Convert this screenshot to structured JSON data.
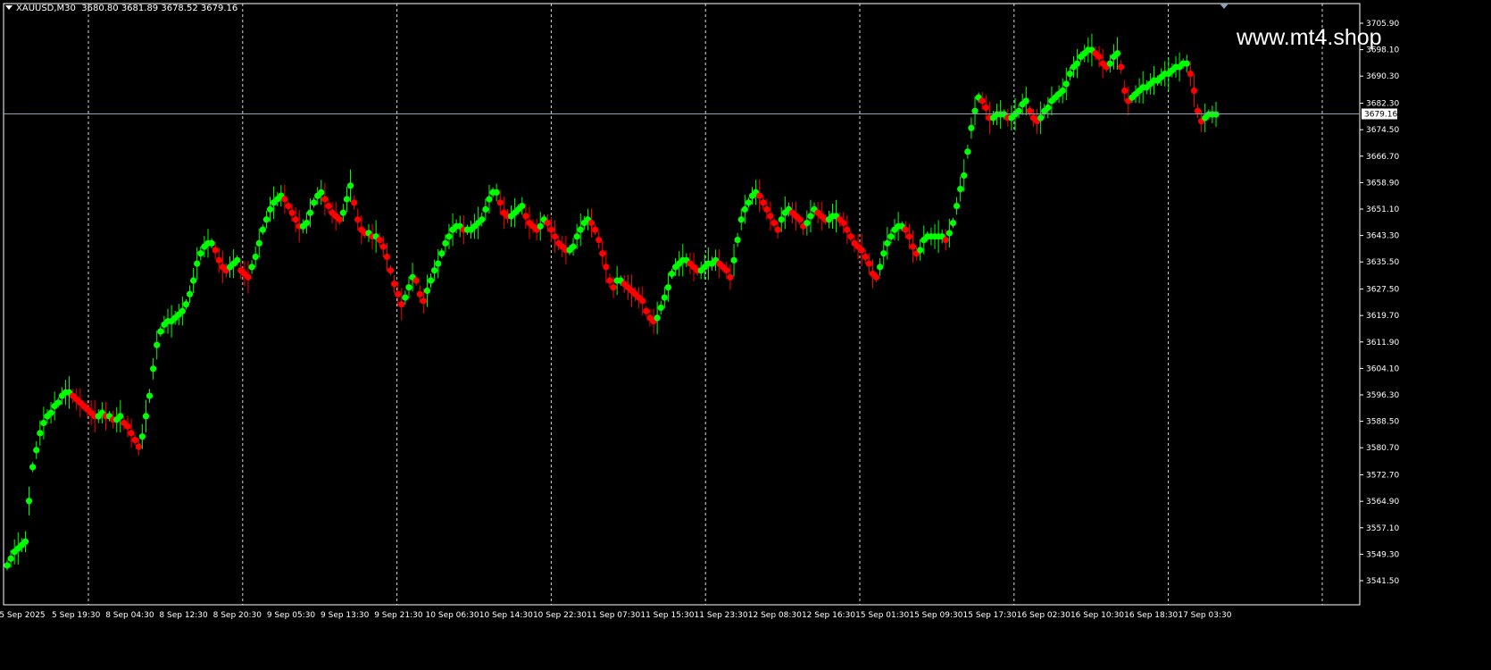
{
  "header": {
    "symbol": "XAUUSD,M30",
    "ohlc": "3680.80 3681.89 3678.52 3679.16"
  },
  "watermark": "www.mt4.shop",
  "colors": {
    "background": "#000000",
    "grid": "#ffffff",
    "up": "#00ff00",
    "down": "#ff0000",
    "price_line": "#8da2b4",
    "text": "#ffffff"
  },
  "chart_data": {
    "type": "line",
    "x_ticks": [
      "5 Sep 2025",
      "5 Sep 19:30",
      "8 Sep 04:30",
      "8 Sep 12:30",
      "8 Sep 20:30",
      "9 Sep 05:30",
      "9 Sep 13:30",
      "9 Sep 21:30",
      "10 Sep 06:30",
      "10 Sep 14:30",
      "10 Sep 22:30",
      "11 Sep 07:30",
      "11 Sep 15:30",
      "11 Sep 23:30",
      "12 Sep 08:30",
      "12 Sep 16:30",
      "15 Sep 01:30",
      "15 Sep 09:30",
      "15 Sep 17:30",
      "16 Sep 02:30",
      "16 Sep 10:30",
      "16 Sep 18:30",
      "17 Sep 03:30"
    ],
    "y_ticks": [
      "3705.90",
      "3698.10",
      "3690.30",
      "3682.30",
      "3674.50",
      "3666.70",
      "3658.90",
      "3651.10",
      "3643.30",
      "3635.50",
      "3627.50",
      "3619.70",
      "3611.90",
      "3604.10",
      "3596.30",
      "3588.50",
      "3580.70",
      "3572.70",
      "3564.90",
      "3557.10",
      "3549.30",
      "3541.50"
    ],
    "ylim": [
      3541.5,
      3705.9
    ],
    "current_price": "3679.16",
    "grid": "vertical dashed",
    "series": [
      {
        "values": [
          3546,
          3548,
          3550,
          3551,
          3552,
          3553,
          3565,
          3575,
          3580,
          3585,
          3588,
          3590,
          3591,
          3593,
          3594,
          3596,
          3597,
          3597,
          3596,
          3595,
          3594,
          3593,
          3592,
          3591,
          3590,
          3590,
          3591,
          3590,
          3590,
          3589,
          3589,
          3590,
          3588,
          3587,
          3585,
          3583,
          3581,
          3584,
          3590,
          3596,
          3604,
          3611,
          3615,
          3617,
          3618,
          3618,
          3619,
          3620,
          3621,
          3623,
          3626,
          3630,
          3635,
          3638,
          3640,
          3641,
          3641,
          3639,
          3636,
          3634,
          3633,
          3634,
          3635,
          3636,
          3633,
          3632,
          3631,
          3634,
          3637,
          3641,
          3645,
          3648,
          3651,
          3653,
          3654,
          3655,
          3654,
          3652,
          3650,
          3648,
          3646,
          3646,
          3647,
          3650,
          3653,
          3655,
          3656,
          3654,
          3652,
          3650,
          3649,
          3648,
          3650,
          3654,
          3658,
          3653,
          3648,
          3645,
          3644,
          3644,
          3643,
          3643,
          3642,
          3640,
          3637,
          3633,
          3629,
          3626,
          3623,
          3625,
          3628,
          3631,
          3630,
          3626,
          3624,
          3627,
          3630,
          3633,
          3635,
          3638,
          3641,
          3643,
          3645,
          3646,
          3646,
          3645,
          3645,
          3645,
          3646,
          3647,
          3648,
          3651,
          3654,
          3656,
          3656,
          3653,
          3650,
          3649,
          3649,
          3650,
          3651,
          3652,
          3649,
          3647,
          3646,
          3645,
          3646,
          3648,
          3647,
          3645,
          3643,
          3641,
          3640,
          3639,
          3639,
          3640,
          3643,
          3645,
          3647,
          3648,
          3647,
          3645,
          3642,
          3638,
          3634,
          3630,
          3628,
          3630,
          3630,
          3629,
          3628,
          3627,
          3626,
          3625,
          3624,
          3621,
          3619,
          3618,
          3619,
          3622,
          3625,
          3628,
          3632,
          3634,
          3635,
          3636,
          3636,
          3635,
          3634,
          3633,
          3633,
          3634,
          3635,
          3635,
          3636,
          3635,
          3634,
          3633,
          3631,
          3636,
          3642,
          3648,
          3651,
          3653,
          3655,
          3656,
          3655,
          3653,
          3651,
          3649,
          3647,
          3645,
          3648,
          3650,
          3651,
          3650,
          3649,
          3648,
          3646,
          3647,
          3649,
          3651,
          3650,
          3649,
          3648,
          3648,
          3649,
          3649,
          3648,
          3647,
          3645,
          3643,
          3641,
          3640,
          3639,
          3637,
          3635,
          3632,
          3631,
          3634,
          3638,
          3641,
          3643,
          3645,
          3646,
          3646,
          3645,
          3643,
          3640,
          3638,
          3639,
          3642,
          3643,
          3643,
          3643,
          3643,
          3643,
          3642,
          3644,
          3647,
          3652,
          3657,
          3661,
          3668,
          3675,
          3680,
          3684,
          3683,
          3681,
          3678,
          3678,
          3679,
          3679,
          3679,
          3678,
          3678,
          3679,
          3680,
          3682,
          3683,
          3680,
          3678,
          3677,
          3678,
          3680,
          3681,
          3683,
          3684,
          3685,
          3686,
          3688,
          3691,
          3693,
          3694,
          3696,
          3697,
          3698,
          3698,
          3697,
          3696,
          3694,
          3693,
          3694,
          3696,
          3697,
          3693,
          3686,
          3683,
          3684,
          3685,
          3686,
          3687,
          3687,
          3688,
          3689,
          3689,
          3690,
          3691,
          3691,
          3692,
          3693,
          3693,
          3694,
          3694,
          3691,
          3686,
          3680,
          3677,
          3678,
          3679,
          3679,
          3679
        ]
      }
    ]
  }
}
